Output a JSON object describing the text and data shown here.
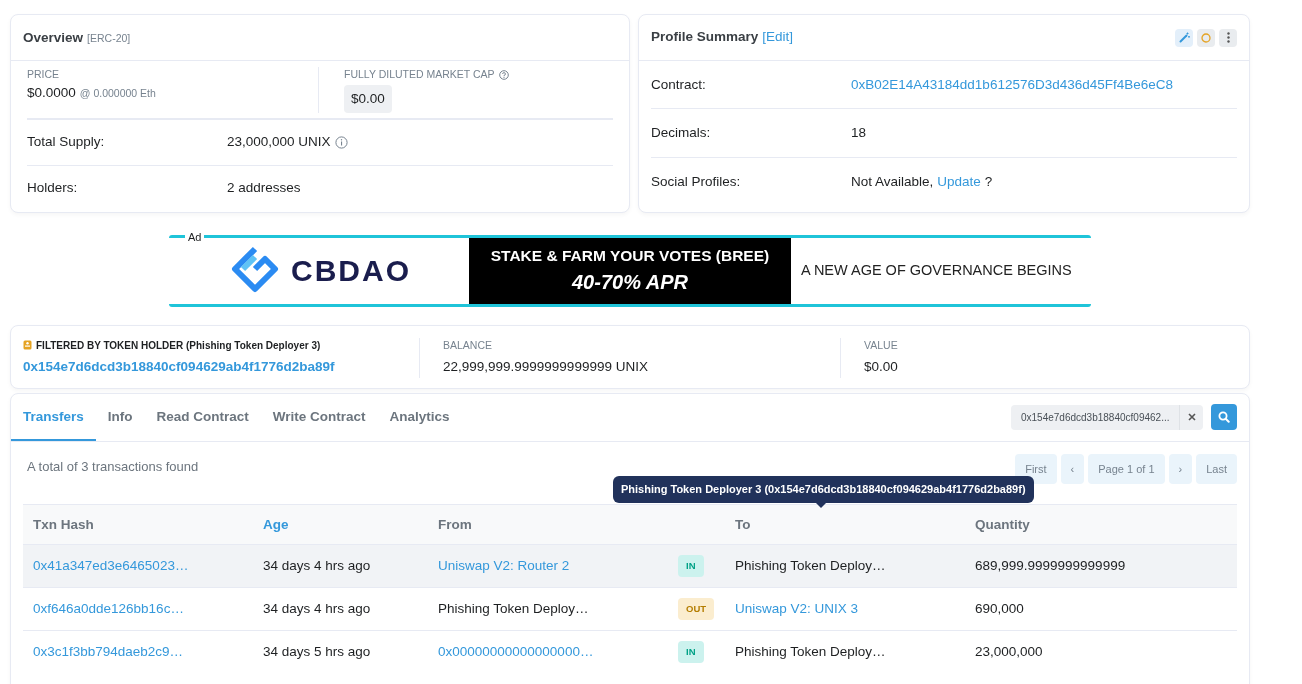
{
  "overview": {
    "title": "Overview",
    "standard": "[ERC-20]",
    "price_label": "PRICE",
    "price": "$0.0000",
    "price_eth": "@ 0.000000 Eth",
    "fdmc_label": "FULLY DILUTED MARKET CAP",
    "fdmc": "$0.00",
    "rows": [
      {
        "label": "Total Supply:",
        "value": "23,000,000 UNIX",
        "info": true
      },
      {
        "label": "Holders:",
        "value": "2 addresses",
        "info": false
      }
    ]
  },
  "profile": {
    "title": "Profile Summary",
    "edit": "[Edit]",
    "rows": [
      {
        "label": "Contract:",
        "kind": "link",
        "value": "0xB02E14A43184dd1b612576D3d436d45Ff4Be6eC8"
      },
      {
        "label": "Decimals:",
        "kind": "text",
        "value": "18"
      },
      {
        "label": "Social Profiles:",
        "kind": "update",
        "value": "Not Available,",
        "link": "Update",
        "suffix": "?"
      }
    ]
  },
  "ad": {
    "label": "Ad",
    "brand": "CBDAO",
    "headline": "STAKE & FARM YOUR VOTES (BREE)",
    "offer": "40-70% APR",
    "tagline": "A NEW AGE OF GOVERNANCE BEGINS"
  },
  "filter": {
    "title": "FILTERED BY TOKEN HOLDER (Phishing Token Deployer 3)",
    "address": "0x154e7d6dcd3b18840cf094629ab4f1776d2ba89f",
    "balance_label": "BALANCE",
    "balance": "22,999,999.9999999999999 UNIX",
    "value_label": "VALUE",
    "value": "$0.00"
  },
  "tabs": [
    {
      "label": "Transfers",
      "selected": true
    },
    {
      "label": "Info",
      "selected": false
    },
    {
      "label": "Read Contract",
      "selected": false
    },
    {
      "label": "Write Contract",
      "selected": false
    },
    {
      "label": "Analytics",
      "selected": false
    }
  ],
  "search": {
    "value": "0x154e7d6dcd3b18840cf09462..."
  },
  "summary": "A total of 3 transactions found",
  "pager": [
    "First",
    "‹",
    "Page 1 of 1",
    "›",
    "Last"
  ],
  "table": {
    "columns": [
      {
        "label": "Txn Hash",
        "sortable": false
      },
      {
        "label": "Age",
        "sortable": true
      },
      {
        "label": "From",
        "sortable": false
      },
      {
        "label": "To",
        "sortable": false
      },
      {
        "label": "Quantity",
        "sortable": false
      }
    ],
    "rows": [
      {
        "hash": "0x41a347ed3e6465023…",
        "age": "34 days 4 hrs ago",
        "from": {
          "text": "Uniswap V2: Router 2",
          "kind": "link"
        },
        "direction": "IN",
        "to": {
          "text": "Phishing Token Deploy…",
          "kind": "plain"
        },
        "quantity": "689,999.9999999999999",
        "selected": true
      },
      {
        "hash": "0xf646a0dde126bb16c…",
        "age": "34 days 4 hrs ago",
        "from": {
          "text": "Phishing Token Deploy…",
          "kind": "plain"
        },
        "direction": "OUT",
        "to": {
          "text": "Uniswap V2: UNIX 3",
          "kind": "link"
        },
        "quantity": "690,000",
        "selected": false
      },
      {
        "hash": "0x3c1f3bb794daeb2c9…",
        "age": "34 days 5 hrs ago",
        "from": {
          "text": "0x00000000000000000…",
          "kind": "link"
        },
        "direction": "IN",
        "to": {
          "text": "Phishing Token Deploy…",
          "kind": "plain"
        },
        "quantity": "23,000,000",
        "selected": false
      }
    ]
  },
  "tooltip": "Phishing Token Deployer 3 (0x154e7d6dcd3b18840cf094629ab4f1776d2ba89f)"
}
